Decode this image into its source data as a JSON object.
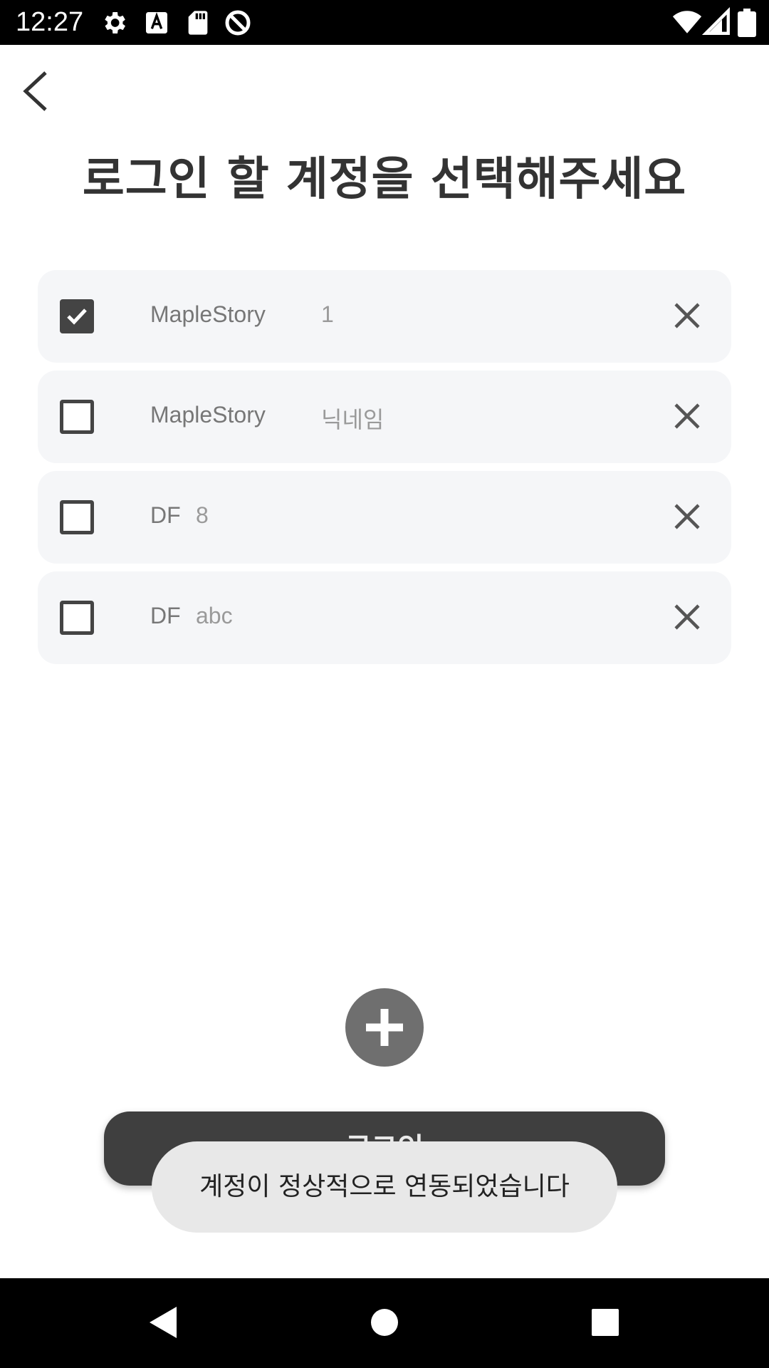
{
  "status_bar": {
    "time": "12:27",
    "left_icons": [
      "gear-icon",
      "font-a-icon",
      "sd-card-icon",
      "do-not-disturb-icon"
    ],
    "right_icons": [
      "wifi-icon",
      "signal-icon",
      "battery-icon"
    ]
  },
  "header": {
    "back_icon": "chevron-left-icon",
    "title": "로그인 할 계정을 선택해주세요"
  },
  "accounts": [
    {
      "game": "MapleStory",
      "name": "1",
      "checked": true
    },
    {
      "game": "MapleStory",
      "name": "닉네임",
      "checked": false
    },
    {
      "game": "DF",
      "name": "8",
      "checked": false
    },
    {
      "game": "DF",
      "name": "abc",
      "checked": false
    }
  ],
  "add_button": {
    "icon": "plus-icon"
  },
  "login_button": {
    "label": "로그인"
  },
  "toast": {
    "message": "계정이 정상적으로 연동되었습니다"
  },
  "nav_bar": {
    "icons": [
      "back-triangle-icon",
      "home-circle-icon",
      "recents-square-icon"
    ]
  },
  "colors": {
    "row_background": "#f5f6f8",
    "login_button": "#3f3f3f",
    "add_button": "#6f6f6f",
    "toast": "#e8e8e8"
  }
}
